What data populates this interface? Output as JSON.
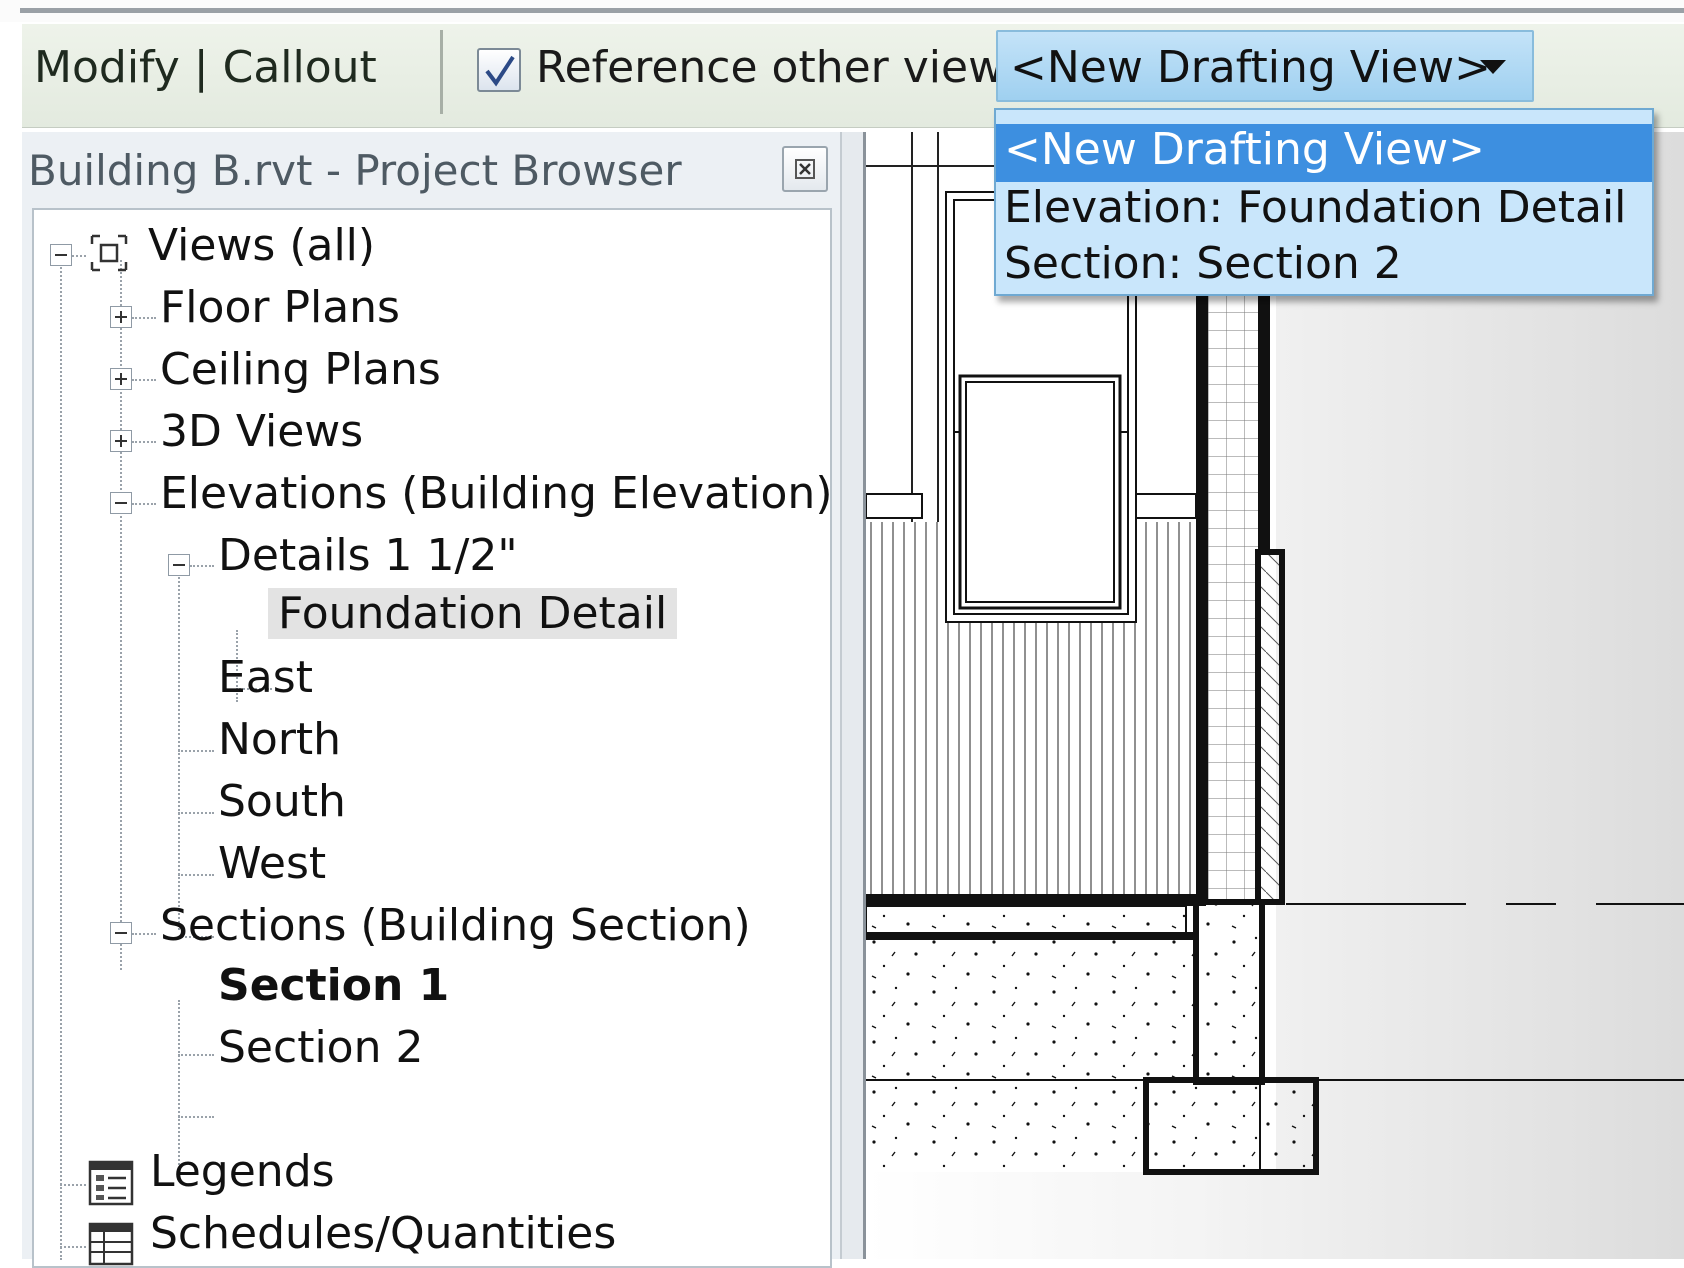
{
  "options_bar": {
    "context_title": "Modify | Callout",
    "reference_label": "Reference other view:",
    "reference_checked": true,
    "selected_view": "<New Drafting View>"
  },
  "view_dropdown": {
    "options": [
      "<New Drafting View>",
      "Elevation: Foundation Detail",
      "Section: Section 2"
    ],
    "selected_index": 0
  },
  "project_browser": {
    "title": "Building B.rvt - Project Browser",
    "tree": {
      "views_all": "Views (all)",
      "floor_plans": "Floor Plans",
      "ceiling_plans": "Ceiling Plans",
      "views_3d": "3D Views",
      "elevations": "Elevations (Building Elevation)",
      "details": "Details 1 1/2\"",
      "foundation_detail": "Foundation Detail",
      "east": "East",
      "north": "North",
      "south": "South",
      "west": "West",
      "sections": "Sections (Building Section)",
      "section_1": "Section 1",
      "section_2": "Section 2",
      "legends": "Legends",
      "schedules": "Schedules/Quantities"
    }
  },
  "icons": {
    "views": "views-icon",
    "legends": "legends-icon",
    "schedules": "schedules-icon",
    "close": "close-icon",
    "chevron": "chevron-down-icon",
    "check": "checkmark-icon"
  },
  "colors": {
    "options_bar_bg": "#e7ede3",
    "dropdown_bg": "#c9e6fb",
    "dropdown_selected": "#3d8fe0",
    "highlight_row": "#e3e3e3"
  }
}
